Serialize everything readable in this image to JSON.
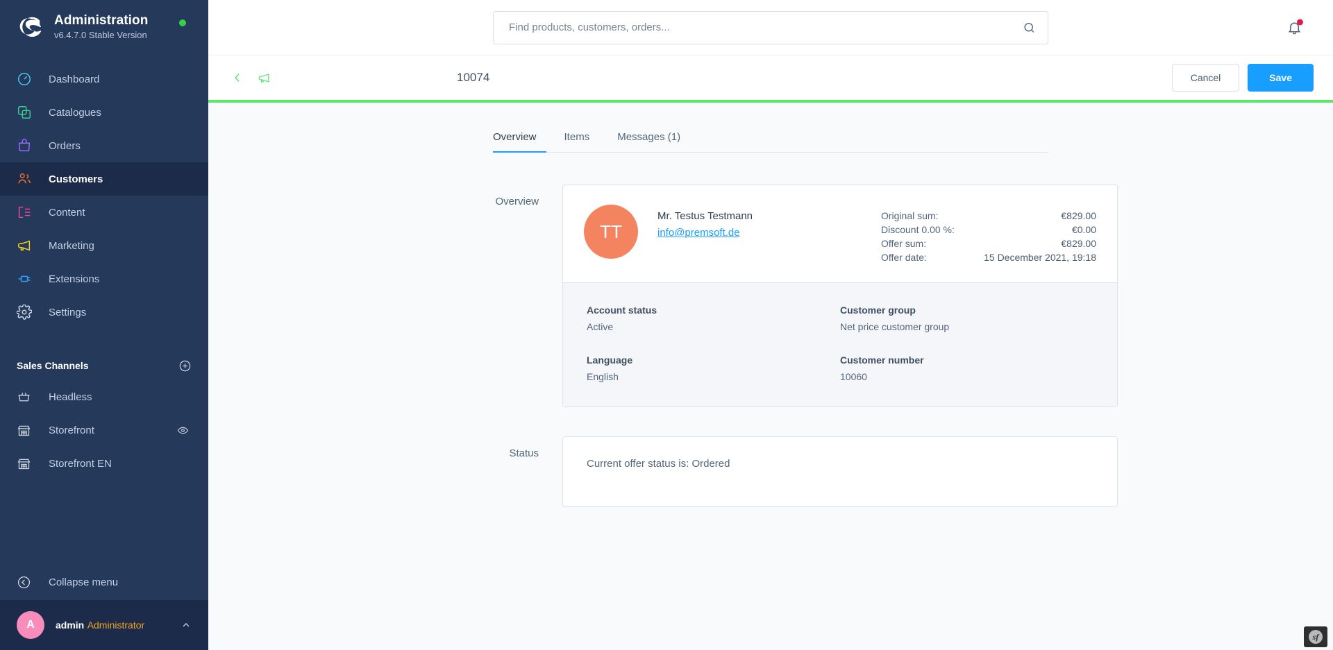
{
  "sidebar": {
    "brand": {
      "title": "Administration",
      "version": "v6.4.7.0 Stable Version",
      "status_dot_color": "#37d046"
    },
    "items": [
      {
        "label": "Dashboard",
        "icon": "dashboard-gauge-icon",
        "color": "#4dc6f5",
        "active": false
      },
      {
        "label": "Catalogues",
        "icon": "catalogue-copy-icon",
        "color": "#3ecf8e",
        "active": false
      },
      {
        "label": "Orders",
        "icon": "orders-bag-icon",
        "color": "#9a6cff",
        "active": false
      },
      {
        "label": "Customers",
        "icon": "customers-people-icon",
        "color": "#f0742c",
        "active": true
      },
      {
        "label": "Content",
        "icon": "content-layout-icon",
        "color": "#ec4899",
        "active": false
      },
      {
        "label": "Marketing",
        "icon": "marketing-megaphone-icon",
        "color": "#f5d416",
        "active": false
      },
      {
        "label": "Extensions",
        "icon": "extensions-plug-icon",
        "color": "#2ea7ff",
        "active": false
      },
      {
        "label": "Settings",
        "icon": "settings-gear-icon",
        "color": "#cfd7e3",
        "active": false
      }
    ],
    "sales_channels_heading": "Sales Channels",
    "add_sales_channel_icon": "plus-circle-icon",
    "sales_channels": [
      {
        "label": "Headless",
        "icon": "headless-basket-icon",
        "has_preview": false
      },
      {
        "label": "Storefront",
        "icon": "storefront-shop-icon",
        "has_preview": true
      },
      {
        "label": "Storefront EN",
        "icon": "storefront-shop-icon",
        "has_preview": false
      }
    ],
    "collapse": {
      "label": "Collapse menu",
      "icon": "collapse-arrow-icon"
    },
    "user": {
      "initial": "A",
      "name": "admin",
      "role": "Administrator",
      "chevron": "chevron-up-icon",
      "avatar_color": "#f88dbb"
    }
  },
  "topbar": {
    "search_placeholder": "Find products, customers, orders...",
    "search_value": "",
    "search_icon": "search-icon",
    "notification_icon": "bell-icon",
    "notification_badge_color": "#d8214c"
  },
  "smart_bar": {
    "back_icon": "chevron-left-icon",
    "megaphone_icon": "megaphone-icon",
    "title": "10074",
    "cancel_label": "Cancel",
    "save_label": "Save",
    "accent_color": "#5ae86b",
    "primary_color": "#189eff"
  },
  "tabs": [
    {
      "label": "Overview",
      "active": true
    },
    {
      "label": "Items",
      "active": false
    },
    {
      "label": "Messages (1)",
      "active": false
    }
  ],
  "overview": {
    "section_label": "Overview",
    "avatar_initials": "TT",
    "avatar_color": "#f4845f",
    "customer_name": "Mr. Testus Testmann",
    "customer_email": "info@premsoft.de",
    "sums": [
      {
        "label": "Original sum:",
        "value": "€829.00"
      },
      {
        "label": "Discount 0.00 %:",
        "value": "€0.00"
      },
      {
        "label": "Offer sum:",
        "value": "€829.00"
      },
      {
        "label": "Offer date:",
        "value": "15 December 2021, 19:18"
      }
    ],
    "details": [
      {
        "key": "Account status",
        "value": "Active"
      },
      {
        "key": "Customer group",
        "value": "Net price customer group"
      },
      {
        "key": "Language",
        "value": "English"
      },
      {
        "key": "Customer number",
        "value": "10060"
      }
    ]
  },
  "status": {
    "section_label": "Status",
    "text": "Current offer status is: Ordered"
  },
  "debug_toolbar": {
    "label": "sf",
    "icon": "symfony-icon"
  }
}
